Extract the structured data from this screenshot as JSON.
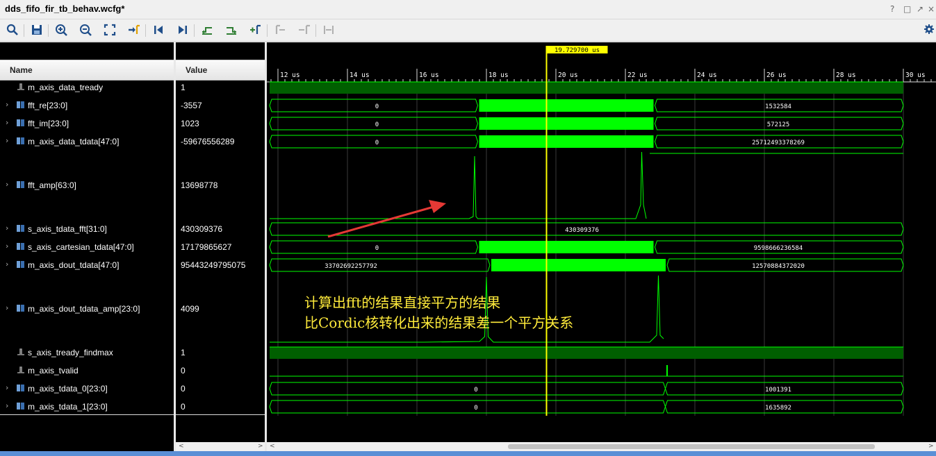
{
  "window": {
    "title": "dds_fifo_fir_tb_behav.wcfg*",
    "controls": [
      "?",
      "□",
      "↗",
      "×"
    ]
  },
  "toolbar": {
    "icons": [
      "search-icon",
      "save-icon",
      "zoom-in-icon",
      "zoom-out-icon",
      "zoom-fit-icon",
      "go-to-cursor-icon",
      "go-to-start-icon",
      "go-to-end-icon",
      "previous-transition-icon",
      "next-transition-icon",
      "add-marker-icon",
      "previous-marker-icon",
      "next-marker-icon",
      "swap-cursors-icon",
      "settings-icon"
    ]
  },
  "columns": {
    "name": "Name",
    "value": "Value"
  },
  "signals": [
    {
      "name": "m_axis_data_tready",
      "value": "1",
      "expandable": false,
      "kind": "bit"
    },
    {
      "name": "fft_re[23:0]",
      "value": "-3557",
      "expandable": true,
      "kind": "bus"
    },
    {
      "name": "fft_im[23:0]",
      "value": "1023",
      "expandable": true,
      "kind": "bus"
    },
    {
      "name": "m_axis_data_tdata[47:0]",
      "value": "-59676556289",
      "expandable": true,
      "kind": "bus"
    },
    {
      "name": "fft_amp[63:0]",
      "value": "13698778",
      "expandable": true,
      "kind": "bus"
    },
    {
      "name": "s_axis_tdata_fft[31:0]",
      "value": "430309376",
      "expandable": true,
      "kind": "bus"
    },
    {
      "name": "s_axis_cartesian_tdata[47:0]",
      "value": "17179865627",
      "expandable": true,
      "kind": "bus"
    },
    {
      "name": "m_axis_dout_tdata[47:0]",
      "value": "95443249795075",
      "expandable": true,
      "kind": "bus"
    },
    {
      "name": "m_axis_dout_tdata_amp[23:0]",
      "value": "4099",
      "expandable": true,
      "kind": "bus"
    },
    {
      "name": "s_axis_tready_findmax",
      "value": "1",
      "expandable": false,
      "kind": "bit"
    },
    {
      "name": "m_axis_tvalid",
      "value": "0",
      "expandable": false,
      "kind": "bit"
    },
    {
      "name": "m_axis_tdata_0[23:0]",
      "value": "0",
      "expandable": true,
      "kind": "bus"
    },
    {
      "name": "m_axis_tdata_1[23:0]",
      "value": "0",
      "expandable": true,
      "kind": "bus"
    }
  ],
  "timeline": {
    "cursor": "19.729700 us",
    "ticks": [
      "12 us",
      "14 us",
      "16 us",
      "18 us",
      "20 us",
      "22 us",
      "24 us",
      "26 us",
      "28 us",
      "30 us"
    ],
    "tick_values": [
      12,
      14,
      16,
      18,
      20,
      22,
      24,
      26,
      28,
      30
    ],
    "start_us": 11.7,
    "end_us": 30.8,
    "cursor_us": 19.7297
  },
  "wave_labels": {
    "fft_re": [
      "0",
      "1532584"
    ],
    "fft_im": [
      "0",
      "572125"
    ],
    "m_axis_data_tdata": [
      "0",
      "25712493378269"
    ],
    "s_axis_tdata_fft": [
      "430309376"
    ],
    "s_axis_cartesian_tdata": [
      "0",
      "9598666236584"
    ],
    "m_axis_dout_tdata": [
      "33702692257792",
      "12570884372020"
    ],
    "m_axis_tdata_0": [
      "0",
      "1001391"
    ],
    "m_axis_tdata_1": [
      "0",
      "1635892"
    ]
  },
  "annotation": {
    "line1": "计算出fft的结果直接平方的结果",
    "line2": "比Cordic核转化出来的结果差一个平方关系",
    "color": "#ffeb3b",
    "arrow_color": "#e53935"
  },
  "colors": {
    "wave": "#00ff00",
    "wave_dark": "#005f00",
    "cursor": "#ffff00",
    "grid": "#3a3a3a"
  }
}
